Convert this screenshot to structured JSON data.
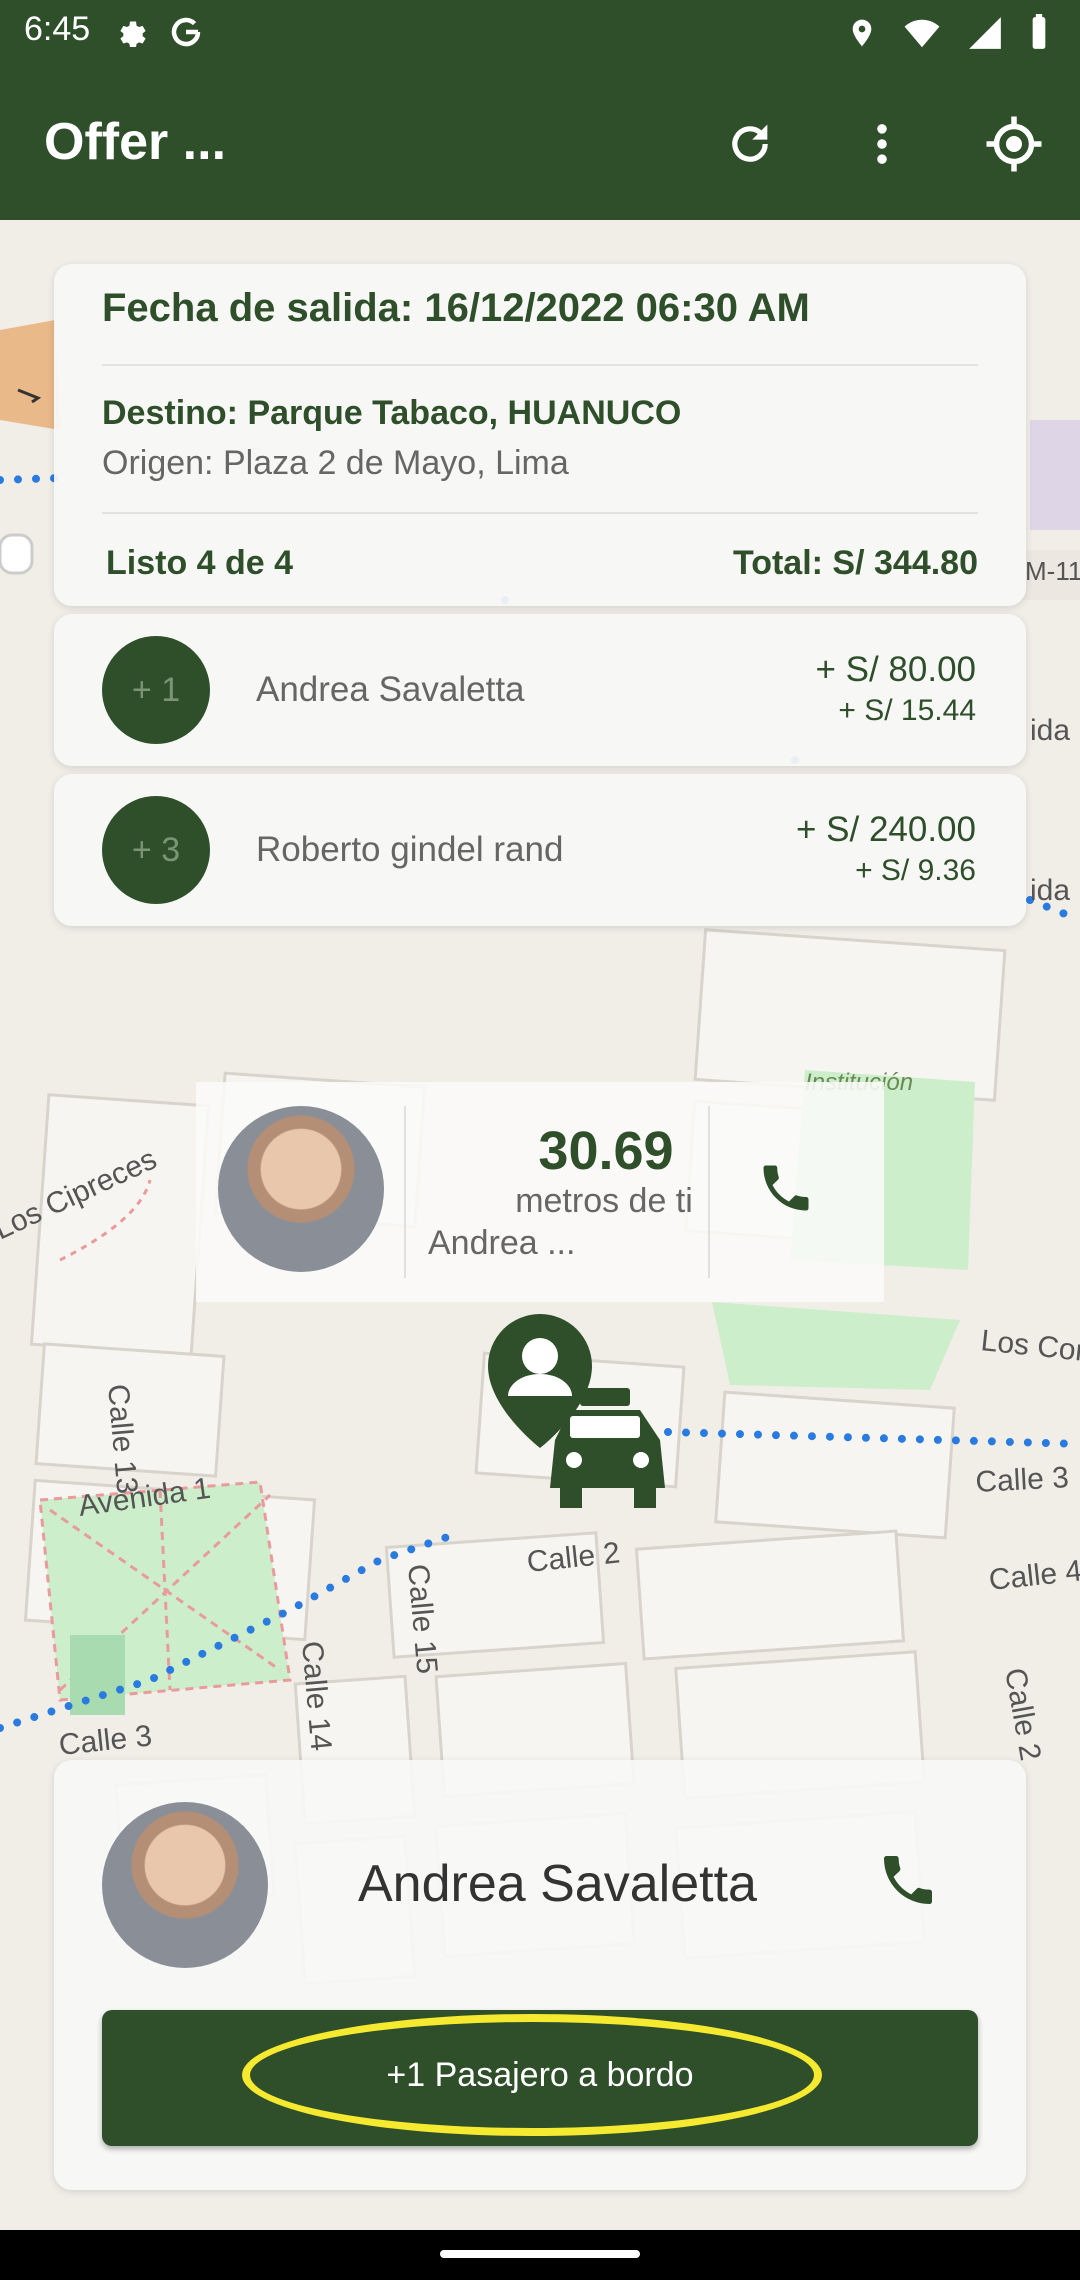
{
  "status_bar": {
    "time": "6:45"
  },
  "app_bar": {
    "title": "Offer ..."
  },
  "trip": {
    "date": "Fecha de salida: 16/12/2022 06:30 AM",
    "destination": "Destino: Parque Tabaco, HUANUCO",
    "origin": "Origen: Plaza 2 de Mayo, Lima",
    "ready": "Listo 4 de 4",
    "total": "Total: S/ 344.80"
  },
  "passengers": [
    {
      "badge": "+ 1",
      "name": "Andrea Savaletta",
      "fare": "+ S/ 80.00",
      "fee": "+ S/ 15.44"
    },
    {
      "badge": "+ 3",
      "name": "Roberto gindel rand",
      "fare": "+ S/ 240.00",
      "fee": "+ S/ 9.36"
    }
  ],
  "nearby": {
    "distance": "30.69",
    "unit": "metros de ti",
    "who": "Andrea ..."
  },
  "map_labels": {
    "cipreces": "Los Cipreces",
    "institucion": "Institución",
    "los_cor": "Los Cor",
    "avenida1": "Avenida 1",
    "calle13": "Calle 13",
    "calle2": "Calle 2",
    "calle3_right": "Calle 3",
    "calle4": "Calle 4",
    "calle15": "Calle 15",
    "calle14": "Calle 14",
    "calle3_left": "Calle 3",
    "calle2_right": "Calle 2",
    "m1": "M-11",
    "ida1": "ida",
    "ida2": "ida"
  },
  "bottom": {
    "name": "Andrea Savaletta",
    "board_label": "+1 Pasajero a bordo"
  },
  "colors": {
    "primary": "#2f4f2b",
    "highlight": "#f5ea2f",
    "route": "#2a7be0"
  }
}
